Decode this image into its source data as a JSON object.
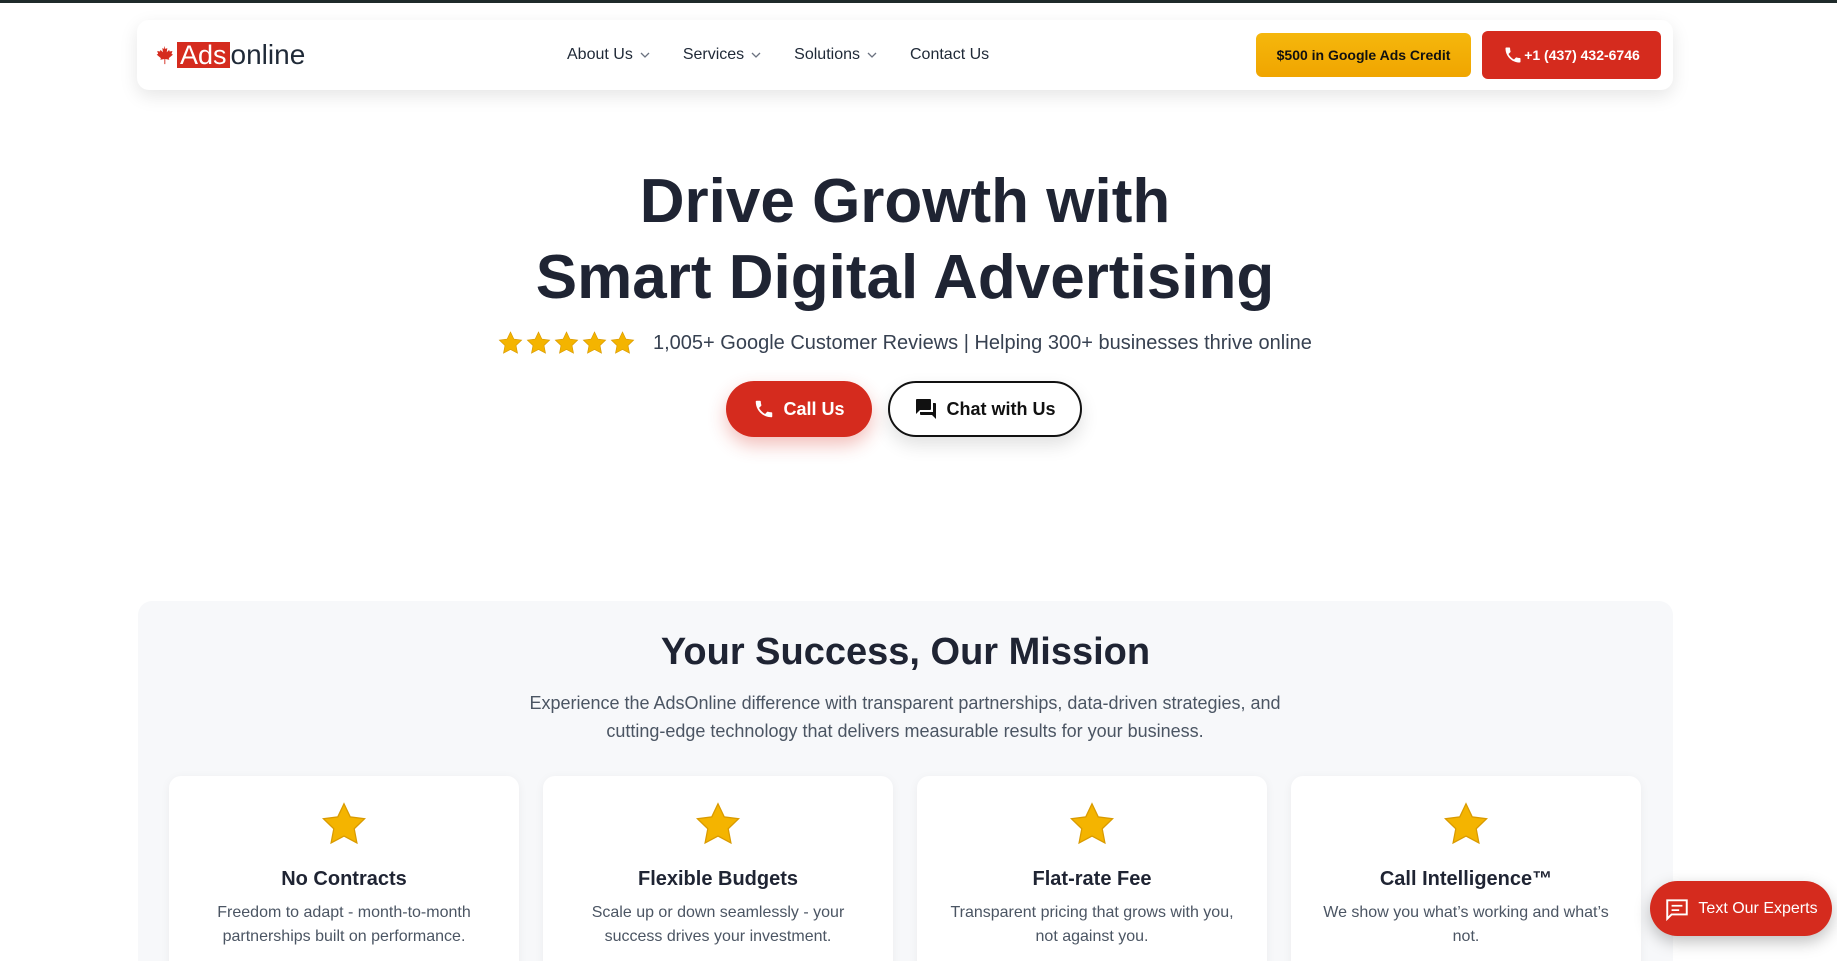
{
  "brand": {
    "name_highlight": "Ads",
    "name_rest": "online",
    "accent": "#d52b1e",
    "credit_color": "#f5b70c"
  },
  "nav": {
    "items": [
      {
        "label": "About Us",
        "dropdown": true
      },
      {
        "label": "Services",
        "dropdown": true
      },
      {
        "label": "Solutions",
        "dropdown": true
      },
      {
        "label": "Contact Us",
        "dropdown": false
      }
    ],
    "credit_button": "$500 in Google Ads Credit",
    "phone_button": "+1 (437) 432-6746"
  },
  "hero": {
    "title_line1": "Drive Growth with",
    "title_line2": "Smart Digital Advertising",
    "rating_stars": 5,
    "subtitle": "1,005+ Google Customer Reviews | Helping 300+ businesses thrive online",
    "call_button": "Call Us",
    "chat_button": "Chat with Us"
  },
  "mission": {
    "title": "Your Success, Our Mission",
    "text_line1": "Experience the AdsOnline difference with transparent partnerships, data-driven strategies, and",
    "text_line2": "cutting-edge technology that delivers measurable results for your business.",
    "cards": [
      {
        "title": "No Contracts",
        "line1": "Freedom to adapt - month-to-month",
        "line2": "partnerships built on performance."
      },
      {
        "title": "Flexible Budgets",
        "line1": "Scale up or down seamlessly - your",
        "line2": "success drives your investment."
      },
      {
        "title": "Flat-rate Fee",
        "line1": "Transparent pricing that grows with you,",
        "line2": "not against you."
      },
      {
        "title": "Call Intelligence™",
        "line1": "We show you what’s working and what’s",
        "line2": "not."
      }
    ]
  },
  "floating": {
    "label": "Text Our Experts"
  },
  "icons": {
    "maple": "maple-leaf-icon",
    "chevron": "chevron-down-icon",
    "phone": "phone-icon",
    "chat": "chat-icon",
    "star": "star-icon",
    "sms": "message-icon"
  }
}
